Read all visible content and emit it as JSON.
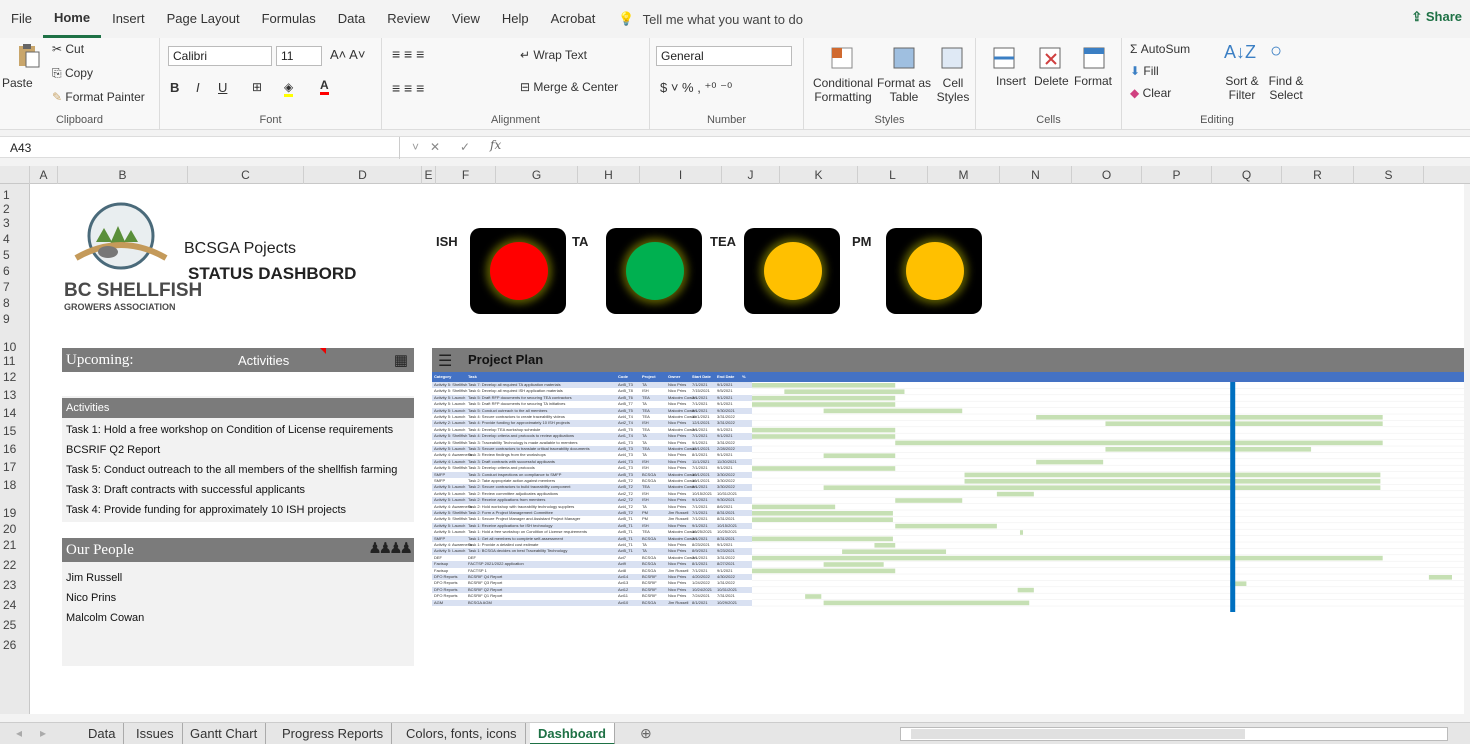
{
  "menu": {
    "tabs": [
      "File",
      "Home",
      "Insert",
      "Page Layout",
      "Formulas",
      "Data",
      "Review",
      "View",
      "Help",
      "Acrobat"
    ],
    "active": "Home",
    "tell_me": "Tell me what you want to do",
    "share": "Share"
  },
  "ribbon": {
    "clipboard": {
      "paste": "Paste",
      "cut": "Cut",
      "copy": "Copy",
      "format_painter": "Format Painter",
      "label": "Clipboard"
    },
    "font": {
      "name": "Calibri",
      "size": "11",
      "label": "Font"
    },
    "alignment": {
      "wrap": "Wrap Text",
      "merge": "Merge & Center",
      "label": "Alignment"
    },
    "number": {
      "format": "General",
      "label": "Number"
    },
    "styles": {
      "conditional": "Conditional Formatting",
      "format_table": "Format as Table",
      "cell_styles": "Cell Styles",
      "label": "Styles"
    },
    "cells": {
      "insert": "Insert",
      "delete": "Delete",
      "format": "Format",
      "label": "Cells"
    },
    "editing": {
      "autosum": "AutoSum",
      "fill": "Fill",
      "clear": "Clear",
      "sort": "Sort & Filter",
      "find": "Find & Select",
      "label": "Editing"
    }
  },
  "formula_bar": {
    "name_box": "A43",
    "fx": "fx",
    "value": ""
  },
  "columns": [
    "A",
    "B",
    "C",
    "D",
    "E",
    "F",
    "G",
    "H",
    "I",
    "J",
    "K",
    "L",
    "M",
    "N",
    "O",
    "P",
    "Q",
    "R",
    "S",
    "T"
  ],
  "rows": [
    "1",
    "2",
    "3",
    "4",
    "5",
    "6",
    "7",
    "8",
    "9",
    "10",
    "11",
    "12",
    "13",
    "14",
    "15",
    "16",
    "17",
    "18",
    "19",
    "20",
    "21",
    "22",
    "23",
    "24",
    "25",
    "26"
  ],
  "header": {
    "title": "BCSGA Pojects",
    "subtitle": "STATUS DASHBORD",
    "logo_text_1": "BC SHELLFISH",
    "logo_text_2": "GROWERS ASSOCIATION"
  },
  "lights": [
    {
      "label": "ISH",
      "color": "#ff0000"
    },
    {
      "label": "TA",
      "color": "#00b050"
    },
    {
      "label": "TEA",
      "color": "#ffc000"
    },
    {
      "label": "PM",
      "color": "#ffc000"
    }
  ],
  "upcoming": {
    "title": "Upcoming:",
    "filter": "Activities",
    "list_header": "Activities",
    "items": [
      "Task 1: Hold a free workshop on Condition of License requirements",
      "BCSRIF Q2 Report",
      "Task 5: Conduct outreach to the all members of the shellfish farming",
      "Task 3: Draft contracts with successful applicants",
      "Task 4: Provide funding for approximately 10 ISH projects"
    ]
  },
  "people": {
    "title": "Our People",
    "items": [
      "Jim Russell",
      "Nico Prins",
      "Malcolm Cowan"
    ]
  },
  "gantt": {
    "title": "Project Plan",
    "headers": [
      "Category",
      "Task",
      "Code",
      "Project",
      "Owner",
      "Start Date",
      "End Date",
      "%"
    ],
    "rows": [
      [
        "Activity 5: Shellfish",
        "Task 7: Develop all required TA application materials",
        "Act5_T3",
        "TA",
        "Nico Prins",
        "7/1/2021",
        "9/1/2021"
      ],
      [
        "Activity 5: Shellfish",
        "Task 6: Develop all required ISH application materials",
        "Act5_T8",
        "ISH",
        "Nico Prins",
        "7/15/2021",
        "9/5/2021"
      ],
      [
        "Activity 5: Launch",
        "Task 5: Draft RFP documents for securing TEA contractors",
        "Act5_T6",
        "TEA",
        "Malcolm Cowan",
        "7/1/2021",
        "9/1/2021"
      ],
      [
        "Activity 5: Launch",
        "Task 5: Draft RFP documents for securing TA initiatives",
        "Act5_T7",
        "TA",
        "Nico Prins",
        "7/1/2021",
        "9/1/2021"
      ],
      [
        "Activity 5: Launch",
        "Task 5: Conduct outreach to the all members",
        "Act5_T5",
        "TEA",
        "Malcolm Cowan",
        "8/1/2021",
        "9/30/2021"
      ],
      [
        "Activity 5: Launch",
        "Task 4: Secure contractors to create traceability videos",
        "Act4_T4",
        "TEA",
        "Malcolm Cowan",
        "11/1/2021",
        "3/31/2022"
      ],
      [
        "Activity 2: Launch",
        "Task 4: Provide funding for approximately 10 ISH projects",
        "Act2_T4",
        "ISH",
        "Nico Prins",
        "12/1/2021",
        "3/31/2022"
      ],
      [
        "Activity 5: Launch",
        "Task 4: Develop TEA workshop schedule",
        "Act5_T5",
        "TEA",
        "Malcolm Cowan",
        "7/1/2021",
        "9/1/2021"
      ],
      [
        "Activity 5: Shellfish",
        "Task 4: Develop criteria and protocols to review applications",
        "Act1_T4",
        "TA",
        "Nico Prins",
        "7/1/2021",
        "9/1/2021"
      ],
      [
        "Activity 5: Shellfish",
        "Task 3: Traceability Technology is made available to members",
        "Act1_T3",
        "TA",
        "Nico Prins",
        "9/1/2021",
        "3/31/2022"
      ],
      [
        "Activity 5: Launch",
        "Task 3: Secure contractors to translate critical traceability documents",
        "Act5_T3",
        "TEA",
        "Malcolm Cowan",
        "12/1/2021",
        "2/28/2022"
      ],
      [
        "Activity 4: Awareness",
        "Task 3: Review findings from the workshops",
        "Act4_T3",
        "TA",
        "Nico Prins",
        "8/1/2021",
        "9/1/2021"
      ],
      [
        "Activity 4: Launch",
        "Task 3: Draft contracts with successful applicants",
        "Act4_T3",
        "ISH",
        "Nico Prins",
        "11/1/2021",
        "11/30/2021"
      ],
      [
        "Activity 5: Shellfish",
        "Task 3: Develop criteria and protocols",
        "Act1_T3",
        "ISH",
        "Nico Prins",
        "7/1/2021",
        "9/1/2021"
      ],
      [
        "SMFP",
        "Task 3: Conduct inspections on compliance to SMFP",
        "Act5_T3",
        "BCSGA",
        "Malcolm Cowan",
        "10/1/2021",
        "3/30/2022"
      ],
      [
        "SMFP",
        "Task 2: Take appropriate action against members",
        "Act5_T2",
        "BCSGA",
        "Malcolm Cowan",
        "10/1/2021",
        "3/30/2022"
      ],
      [
        "Activity 5: Launch",
        "Task 2: Secure contractors to build traceability component",
        "Act5_T2",
        "TEA",
        "Malcolm Cowan",
        "8/1/2021",
        "3/30/2022"
      ],
      [
        "Activity 5: Launch",
        "Task 2: Review committee adjudicates applications",
        "Act2_T2",
        "ISH",
        "Nico Prins",
        "10/15/2021",
        "10/31/2021"
      ],
      [
        "Activity 5: Launch",
        "Task 2: Receive applications from members",
        "Act2_T2",
        "ISH",
        "Nico Prins",
        "9/1/2021",
        "9/30/2021"
      ],
      [
        "Activity 4: Awareness",
        "Task 2: Hold workshop with traceability technology suppliers",
        "Act4_T2",
        "TA",
        "Nico Prins",
        "7/1/2021",
        "8/6/2021"
      ],
      [
        "Activity 5: Shellfish",
        "Task 2: Form a Project Management Committee",
        "Act5_T2",
        "PM",
        "Jim Russell",
        "7/1/2021",
        "8/31/2021"
      ],
      [
        "Activity 5: Shellfish",
        "Task 1: Secure Project Manager and Assistant Project Manager",
        "Act5_T1",
        "PM",
        "Jim Russell",
        "7/1/2021",
        "8/31/2021"
      ],
      [
        "Activity 5: Launch",
        "Task 1: Receive applications for ISH technology",
        "Act5_T1",
        "ISH",
        "Nico Prins",
        "9/1/2021",
        "10/15/2021"
      ],
      [
        "Activity 5: Launch",
        "Task 1: Hold a free workshop on Condition of License requirements",
        "Act5_T1",
        "TEA",
        "Malcolm Cowan",
        "10/25/2021",
        "10/25/2021"
      ],
      [
        "SMFP",
        "Task 1: Get all members to complete self-assessment",
        "Act5_T1",
        "BCSGA",
        "Malcolm Cowan",
        "7/1/2021",
        "8/31/2021"
      ],
      [
        "Activity 4: Awareness",
        "Task 1: Provide a detailed cost estimate",
        "Act4_T1",
        "TA",
        "Nico Prins",
        "8/23/2021",
        "9/1/2021"
      ],
      [
        "Activity 5: Launch",
        "Task 1: BCSGA decides on best Traceability Technology",
        "Act5_T1",
        "TA",
        "Nico Prins",
        "8/9/2021",
        "9/23/2021"
      ],
      [
        "DEF",
        "DEF",
        "Act7",
        "BCSGA",
        "Malcolm Cowan",
        "7/1/2021",
        "3/31/2022"
      ],
      [
        "Factsup",
        "FACTSP 2021/2022 application",
        "Act9",
        "BCSGA",
        "Nico Prins",
        "8/1/2021",
        "8/27/2021"
      ],
      [
        "Factsup",
        "FACTSP 1",
        "Act8",
        "BCSGA",
        "Jim Russell",
        "7/1/2021",
        "9/1/2021"
      ],
      [
        "DFO Reports",
        "BCSRIF Q4 Report",
        "Act14",
        "BCSRIF",
        "Nico Prins",
        "4/20/2022",
        "4/30/2022"
      ],
      [
        "DFO Reports",
        "BCSRIF Q3 Report",
        "Act13",
        "BCSRIF",
        "Nico Prins",
        "1/24/2022",
        "1/31/2022"
      ],
      [
        "DFO Reports",
        "BCSRIF Q2 Report",
        "Act12",
        "BCSRIF",
        "Nico Prins",
        "10/24/2021",
        "10/31/2021"
      ],
      [
        "DFO Reports",
        "BCSRIF Q1 Report",
        "Act11",
        "BCSRIF",
        "Nico Prins",
        "7/24/2021",
        "7/31/2021"
      ],
      [
        "AGM",
        "BCSGA AGM",
        "Act10",
        "BCSGA",
        "Jim Russell",
        "8/1/2021",
        "10/29/2021"
      ]
    ]
  },
  "sheet_tabs": [
    "Data",
    "Issues",
    "Gantt Chart",
    "Progress Reports",
    "Colors, fonts, icons",
    "Dashboard"
  ],
  "active_sheet": "Dashboard"
}
